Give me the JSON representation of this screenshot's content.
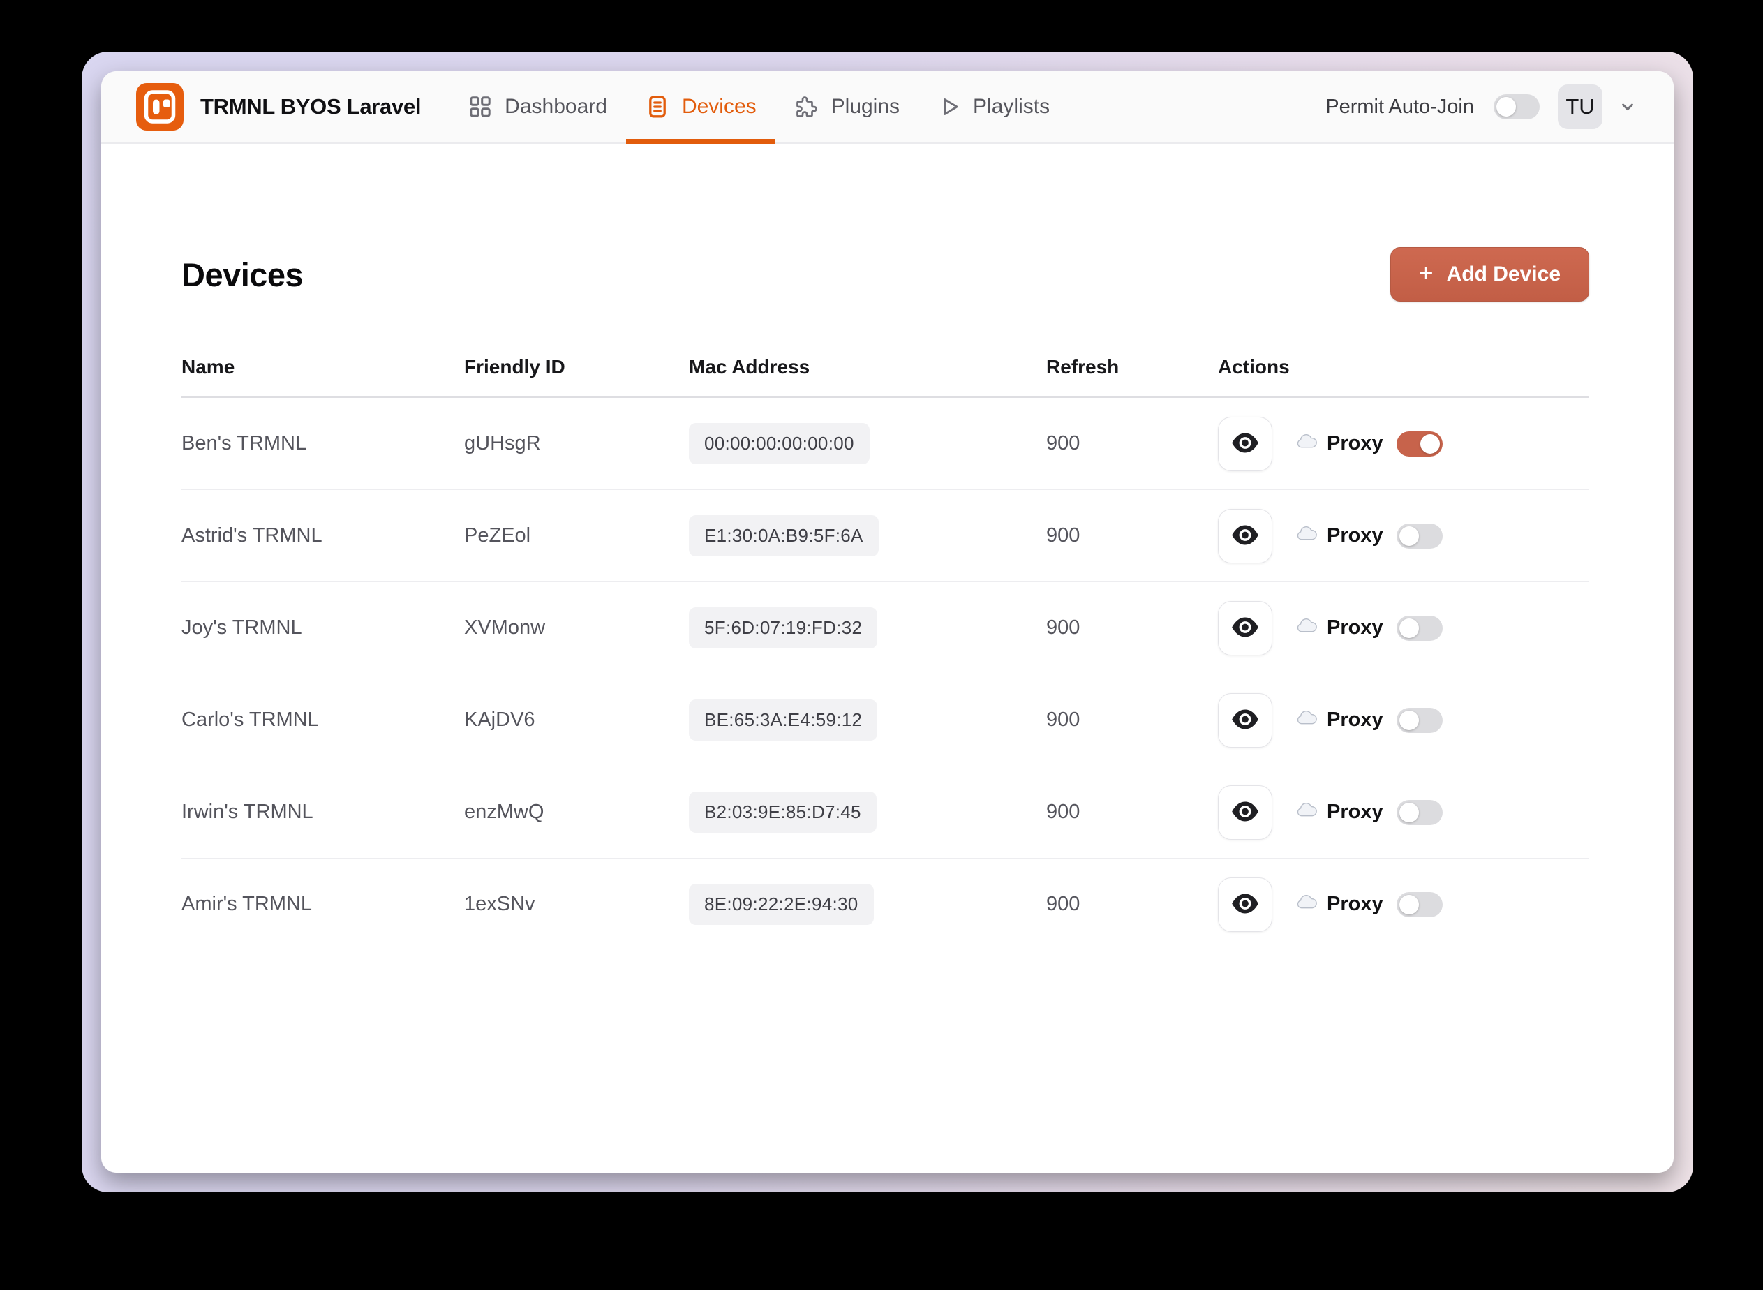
{
  "header": {
    "app_title": "TRMNL BYOS Laravel",
    "nav": [
      {
        "label": "Dashboard",
        "icon": "grid-icon",
        "active": false
      },
      {
        "label": "Devices",
        "icon": "device-list-icon",
        "active": true
      },
      {
        "label": "Plugins",
        "icon": "puzzle-icon",
        "active": false
      },
      {
        "label": "Playlists",
        "icon": "play-icon",
        "active": false
      }
    ],
    "permit_auto_join": {
      "label": "Permit Auto-Join",
      "enabled": false
    },
    "user_initials": "TU"
  },
  "page": {
    "title": "Devices",
    "add_device": {
      "plus": "+",
      "label": "Add Device"
    }
  },
  "table": {
    "columns": [
      "Name",
      "Friendly ID",
      "Mac Address",
      "Refresh",
      "Actions"
    ],
    "rows": [
      {
        "name": "Ben's TRMNL",
        "friendly_id": "gUHsgR",
        "mac": "00:00:00:00:00:00",
        "refresh": "900",
        "proxy_label": "Proxy",
        "proxy_enabled": true
      },
      {
        "name": "Astrid's TRMNL",
        "friendly_id": "PeZEol",
        "mac": "E1:30:0A:B9:5F:6A",
        "refresh": "900",
        "proxy_label": "Proxy",
        "proxy_enabled": false
      },
      {
        "name": "Joy's TRMNL",
        "friendly_id": "XVMonw",
        "mac": "5F:6D:07:19:FD:32",
        "refresh": "900",
        "proxy_label": "Proxy",
        "proxy_enabled": false
      },
      {
        "name": "Carlo's TRMNL",
        "friendly_id": "KAjDV6",
        "mac": "BE:65:3A:E4:59:12",
        "refresh": "900",
        "proxy_label": "Proxy",
        "proxy_enabled": false
      },
      {
        "name": "Irwin's TRMNL",
        "friendly_id": "enzMwQ",
        "mac": "B2:03:9E:85:D7:45",
        "refresh": "900",
        "proxy_label": "Proxy",
        "proxy_enabled": false
      },
      {
        "name": "Amir's TRMNL",
        "friendly_id": "1exSNv",
        "mac": "8E:09:22:2E:94:30",
        "refresh": "900",
        "proxy_label": "Proxy",
        "proxy_enabled": false
      }
    ]
  },
  "colors": {
    "accent_orange": "#e25c0c",
    "terracotta": "#c7634b",
    "frame_gradient_left": "#d9d6f0",
    "frame_gradient_right": "#eee2e7",
    "header_bg": "#fafafa",
    "row_text": "#54545c"
  }
}
